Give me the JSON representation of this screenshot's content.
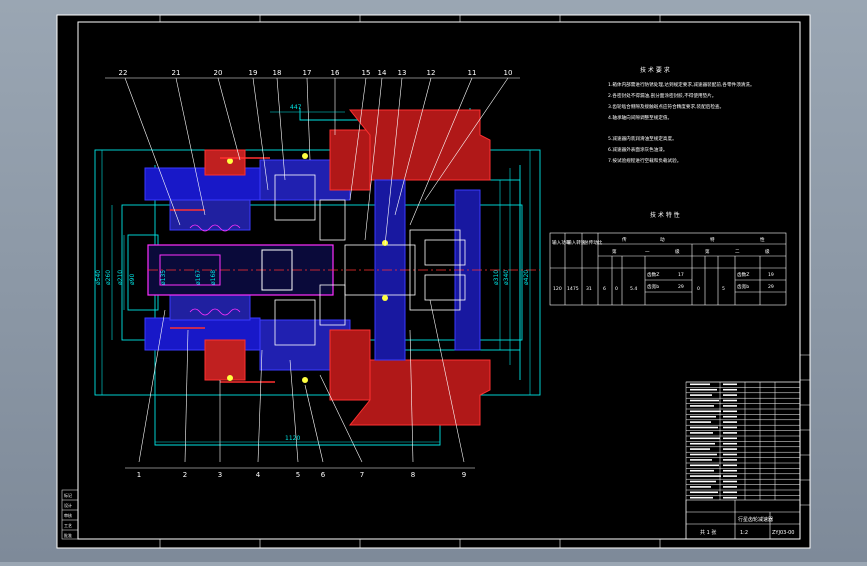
{
  "colors": {
    "desktop": "#8e9aa8",
    "paper": "#000000",
    "frame": "#ffffff",
    "cyan": "#00e5e5",
    "blue": "#3a3aff",
    "red": "#ff3030",
    "magenta": "#ff30ff",
    "yellow": "#ffff40",
    "white": "#ffffff"
  },
  "callouts_top": [
    "22",
    "21",
    "20",
    "19",
    "18",
    "17",
    "16",
    "15",
    "14",
    "13",
    "12",
    "11",
    "10"
  ],
  "callouts_bottom": [
    "1",
    "2",
    "3",
    "4",
    "5",
    "6",
    "7",
    "8",
    "9"
  ],
  "dims": {
    "top": "447",
    "bottom": "1120",
    "left_diameters": [
      "ø540",
      "ø260",
      "ø210",
      "ø90"
    ],
    "right_diameters": [
      "ø310",
      "ø340",
      "ø420"
    ],
    "inner_labels": [
      "ø167",
      "ø168",
      "ø135"
    ]
  },
  "tech_req": {
    "title": "技 术 要 求",
    "lines": [
      "1.箱体内部需进行防锈处理,达到规定要求,减速器装配前,各零件须清洗。",
      "2.各密封处不得漏油,剖分面涂密封胶,不得使用垫片。",
      "3.齿轮啮合侧隙及接触斑点应符合精度要求,装配后检查。",
      "4.轴承轴向间隙调整至规定值。",
      "5.减速器内装润滑油至规定高度。",
      "6.减速器外表面涂灰色油漆。",
      "7.按试验规程进行空载和负载试验。"
    ]
  },
  "spec_table": {
    "title": "技 术 特 性",
    "col_headers": [
      "输入功率",
      "输入转速",
      "总传动比",
      "传",
      "动",
      "特",
      "性"
    ],
    "sub_headers": [
      "第",
      "一",
      "级",
      "第",
      "二",
      "级"
    ],
    "row": [
      "120",
      "1475",
      "31",
      "6",
      "0",
      "5.4",
      "17",
      "29",
      "0",
      "5",
      "19",
      "29"
    ],
    "labels": [
      "齿数Z",
      "齿宽b",
      "齿数Z",
      "齿宽b"
    ]
  },
  "title_block": {
    "name": "行星齿轮减速器",
    "drawing_no": "ZYJ03-00",
    "scale": "1:2",
    "sheet": "共 1 张"
  },
  "left_block": [
    "标记",
    "设计",
    "审核",
    "工艺",
    "批准"
  ]
}
